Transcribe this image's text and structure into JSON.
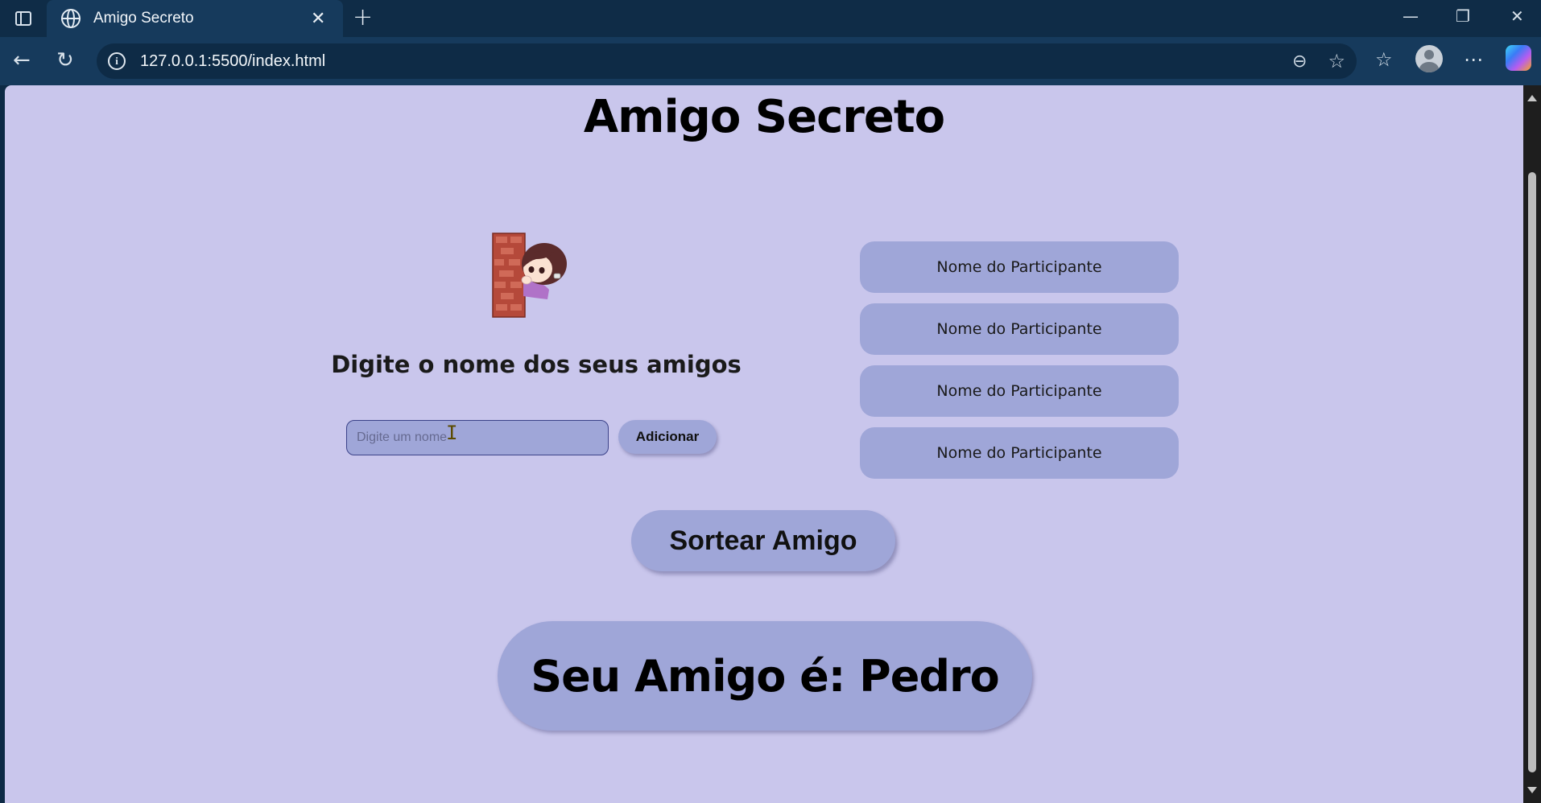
{
  "browser": {
    "tab_title": "Amigo Secreto",
    "url": "127.0.0.1:5500/index.html"
  },
  "page": {
    "title": "Amigo Secreto",
    "prompt": "Digite o nome dos seus amigos",
    "input_placeholder": "Digite um nome",
    "add_label": "Adicionar",
    "participants": [
      {
        "label": "Nome do Participante"
      },
      {
        "label": "Nome do Participante"
      },
      {
        "label": "Nome do Participante"
      },
      {
        "label": "Nome do Participante"
      }
    ],
    "draw_label": "Sortear Amigo",
    "result": "Seu Amigo é: Pedro"
  },
  "colors": {
    "page_background": "#c9c6ec",
    "button_background": "#9fa6d8",
    "chrome_dark": "#0f2c47"
  }
}
